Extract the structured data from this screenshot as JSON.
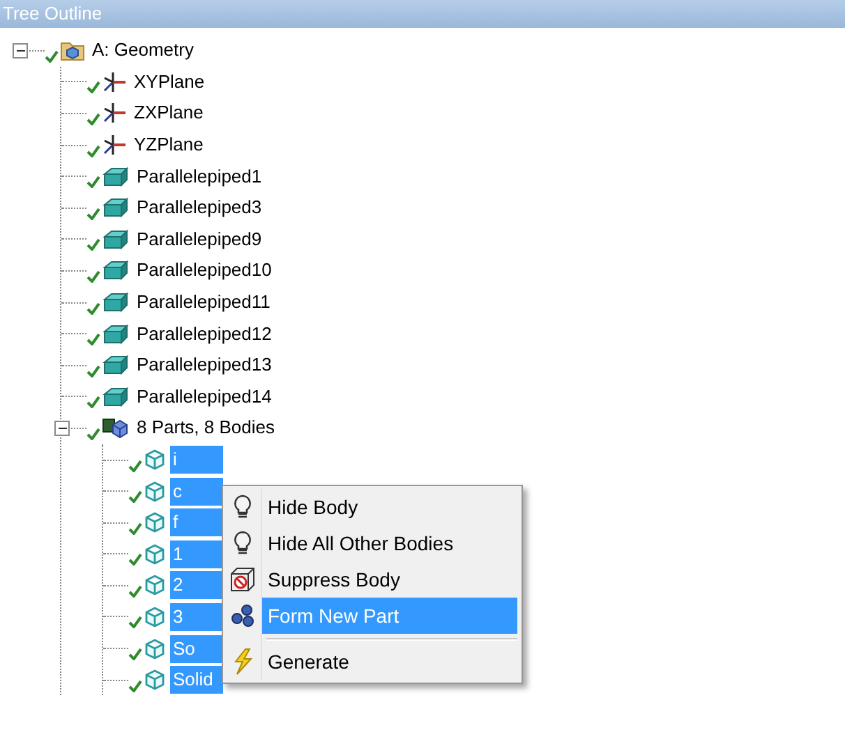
{
  "panel": {
    "title": "Tree Outline"
  },
  "tree": [
    {
      "label": "A: Geometry",
      "kind": "geometry",
      "checked": true,
      "expanded": true,
      "selected": false,
      "children": [
        {
          "label": "XYPlane",
          "kind": "plane",
          "checked": true,
          "selected": false
        },
        {
          "label": "ZXPlane",
          "kind": "plane",
          "checked": true,
          "selected": false
        },
        {
          "label": "YZPlane",
          "kind": "plane",
          "checked": true,
          "selected": false
        },
        {
          "label": "Parallelepiped1",
          "kind": "feature",
          "checked": true,
          "selected": false
        },
        {
          "label": "Parallelepiped3",
          "kind": "feature",
          "checked": true,
          "selected": false
        },
        {
          "label": "Parallelepiped9",
          "kind": "feature",
          "checked": true,
          "selected": false
        },
        {
          "label": "Parallelepiped10",
          "kind": "feature",
          "checked": true,
          "selected": false
        },
        {
          "label": "Parallelepiped11",
          "kind": "feature",
          "checked": true,
          "selected": false
        },
        {
          "label": "Parallelepiped12",
          "kind": "feature",
          "checked": true,
          "selected": false
        },
        {
          "label": "Parallelepiped13",
          "kind": "feature",
          "checked": true,
          "selected": false
        },
        {
          "label": "Parallelepiped14",
          "kind": "feature",
          "checked": true,
          "selected": false
        },
        {
          "label": "8 Parts, 8 Bodies",
          "kind": "parts",
          "checked": true,
          "expanded": true,
          "selected": false,
          "children": [
            {
              "label": "i",
              "kind": "body",
              "checked": true,
              "selected": true
            },
            {
              "label": "c",
              "kind": "body",
              "checked": true,
              "selected": true
            },
            {
              "label": "f",
              "kind": "body",
              "checked": true,
              "selected": true
            },
            {
              "label": "1",
              "kind": "body",
              "checked": true,
              "selected": true
            },
            {
              "label": "2",
              "kind": "body",
              "checked": true,
              "selected": true
            },
            {
              "label": "3",
              "kind": "body",
              "checked": true,
              "selected": true
            },
            {
              "label": "So",
              "kind": "body",
              "checked": true,
              "selected": true
            },
            {
              "label": "Solid",
              "kind": "body",
              "checked": true,
              "selected": true
            }
          ]
        }
      ]
    }
  ],
  "context_menu": [
    {
      "label": "Hide Body",
      "kind": "hide",
      "selected": false
    },
    {
      "label": "Hide All Other Bodies",
      "kind": "hide",
      "selected": false
    },
    {
      "label": "Suppress Body",
      "kind": "suppress",
      "selected": false
    },
    {
      "label": "Form New Part",
      "kind": "form-part",
      "selected": true
    },
    {
      "kind": "separator"
    },
    {
      "label": "Generate",
      "kind": "generate",
      "selected": false
    }
  ]
}
